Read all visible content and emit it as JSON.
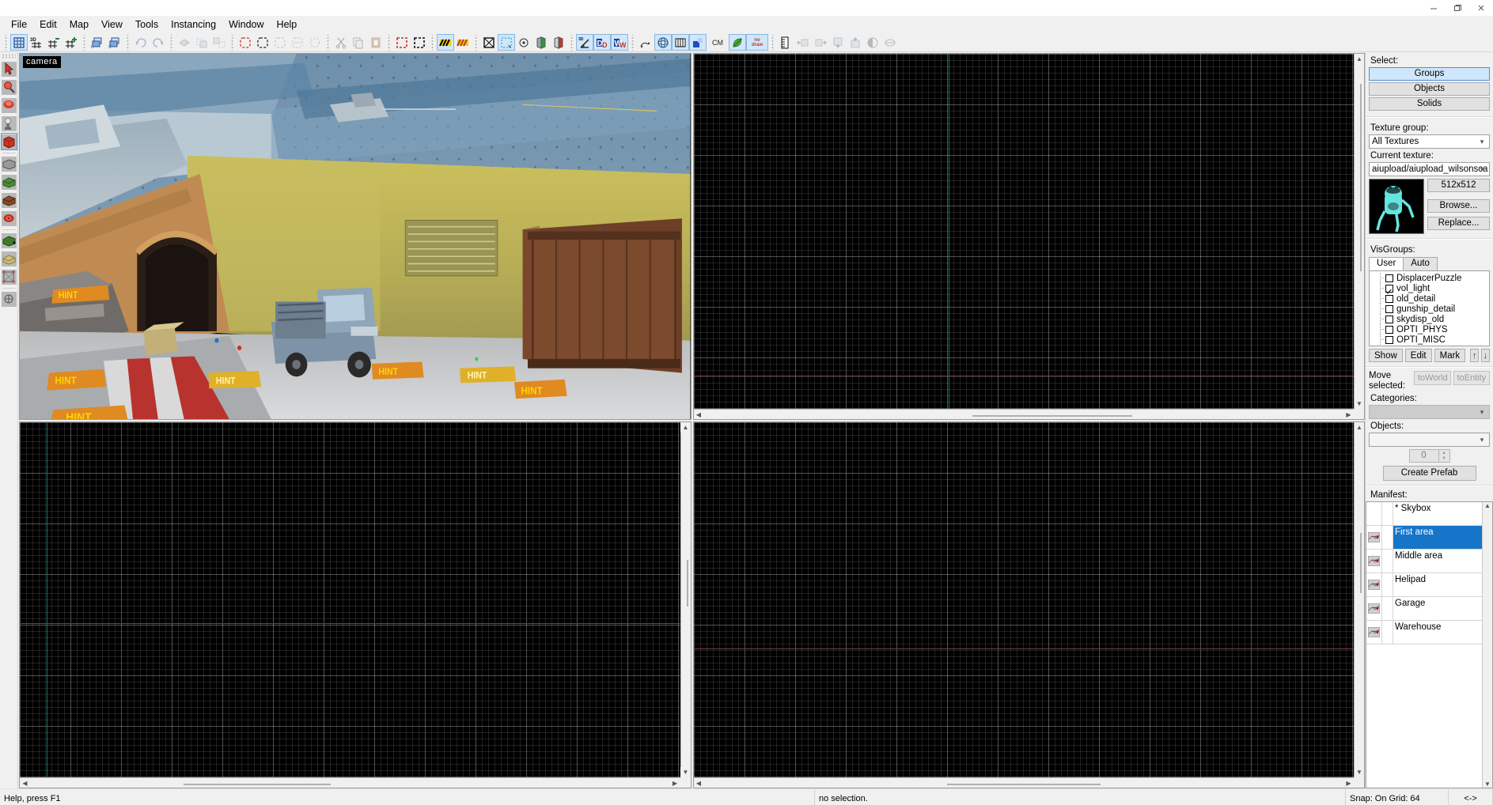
{
  "window": {
    "minimize": "–",
    "maximize": "❐",
    "close": "✕"
  },
  "menubar": {
    "items": [
      {
        "label": "File"
      },
      {
        "label": "Edit"
      },
      {
        "label": "Map"
      },
      {
        "label": "View"
      },
      {
        "label": "Tools"
      },
      {
        "label": "Instancing"
      },
      {
        "label": "Window"
      },
      {
        "label": "Help"
      }
    ]
  },
  "toolbar": {
    "groups": [
      {
        "name": "grid-tools",
        "buttons": [
          {
            "name": "toggle-2d-grid",
            "glyph": "grid2d",
            "active": true
          },
          {
            "name": "toggle-3d-grid",
            "glyph": "grid3d",
            "active": false
          },
          {
            "name": "grid-smaller",
            "glyph": "gridminus",
            "active": false
          },
          {
            "name": "grid-bigger",
            "glyph": "gridplus",
            "active": false
          }
        ]
      },
      {
        "name": "group-tools",
        "buttons": [
          {
            "name": "load-group",
            "glyph": "groupload",
            "active": false
          },
          {
            "name": "save-group",
            "glyph": "groupsave",
            "active": false
          }
        ]
      },
      {
        "name": "history-tools",
        "buttons": [
          {
            "name": "undo",
            "glyph": "undo",
            "active": false,
            "disabled": true
          },
          {
            "name": "redo",
            "glyph": "redo",
            "active": false,
            "disabled": true
          }
        ]
      },
      {
        "name": "carve-tools",
        "buttons": [
          {
            "name": "carve",
            "glyph": "carve",
            "active": false,
            "disabled": true
          },
          {
            "name": "group",
            "glyph": "group",
            "active": false,
            "disabled": true
          },
          {
            "name": "ungroup",
            "glyph": "ungroup",
            "active": false,
            "disabled": true
          }
        ]
      },
      {
        "name": "selection-mode-tools",
        "buttons": [
          {
            "name": "select-groups",
            "glyph": "selgroups",
            "active": false
          },
          {
            "name": "select-objects",
            "glyph": "selobjects",
            "active": false
          },
          {
            "name": "select-solids",
            "glyph": "selsolids",
            "active": false,
            "disabled": true
          },
          {
            "name": "ignore-groups",
            "glyph": "ignoregroups",
            "active": false,
            "disabled": true
          },
          {
            "name": "hide-selection",
            "glyph": "hidesel",
            "active": false,
            "disabled": true
          }
        ]
      },
      {
        "name": "clipboard-tools",
        "buttons": [
          {
            "name": "cut",
            "glyph": "cut",
            "active": false,
            "disabled": true
          },
          {
            "name": "copy",
            "glyph": "copy",
            "active": false,
            "disabled": true
          },
          {
            "name": "paste",
            "glyph": "paste",
            "active": false,
            "disabled": true
          }
        ]
      },
      {
        "name": "cordon-tools",
        "buttons": [
          {
            "name": "toggle-cordon",
            "glyph": "cordon1",
            "active": false
          },
          {
            "name": "edit-cordon",
            "glyph": "cordon2",
            "active": false
          }
        ]
      },
      {
        "name": "texture-lock-tools",
        "buttons": [
          {
            "name": "texture-lock",
            "glyph": "texlock",
            "active": true
          },
          {
            "name": "texture-scale-lock",
            "glyph": "texscalelock",
            "active": false
          }
        ]
      },
      {
        "name": "view-helper-tools",
        "buttons": [
          {
            "name": "toggle-helpers",
            "glyph": "helpers",
            "active": false
          },
          {
            "name": "toggle-texture-tool",
            "glyph": "tltool",
            "active": true
          },
          {
            "name": "toggle-texture-axes",
            "glyph": "texaxes",
            "active": false
          },
          {
            "name": "toggle-models",
            "glyph": "models1",
            "active": false
          },
          {
            "name": "toggle-models-fade",
            "glyph": "models2",
            "active": false
          }
        ]
      },
      {
        "name": "display-tools",
        "buttons": [
          {
            "name": "show-angles",
            "glyph": "angles",
            "active": true
          },
          {
            "name": "show-displacements",
            "glyph": "dispd",
            "active": true
          },
          {
            "name": "show-detail",
            "glyph": "dispw",
            "active": true
          }
        ]
      },
      {
        "name": "render-tools",
        "buttons": [
          {
            "name": "radius-culling",
            "glyph": "radius",
            "active": false
          },
          {
            "name": "world-sphere",
            "glyph": "sphere",
            "active": true
          },
          {
            "name": "show-grid-overlay",
            "glyph": "gridoverlay",
            "active": true
          },
          {
            "name": "show-lightmap",
            "glyph": "lightmap",
            "active": true
          },
          {
            "name": "cordon-mode",
            "glyph": "cm-text",
            "label": "CM",
            "active": false
          },
          {
            "name": "show-detail-leaf",
            "glyph": "leaf",
            "active": true
          },
          {
            "name": "nodraw-toggle",
            "glyph": "nodraw",
            "label": "no draw",
            "active": true
          }
        ]
      },
      {
        "name": "instance-tools",
        "buttons": [
          {
            "name": "manifest-ruler",
            "glyph": "ruler",
            "active": false
          },
          {
            "name": "move-to-previous",
            "glyph": "moveprev",
            "active": false,
            "disabled": true
          },
          {
            "name": "move-to-next",
            "glyph": "movenext",
            "active": false,
            "disabled": true
          },
          {
            "name": "collapse-instance",
            "glyph": "collapse",
            "active": false,
            "disabled": true
          },
          {
            "name": "push-into-instance",
            "glyph": "pushin",
            "active": false,
            "disabled": true
          },
          {
            "name": "half-visible",
            "glyph": "halfvis",
            "active": false,
            "disabled": true
          },
          {
            "name": "hidden-toggle",
            "glyph": "hidetog",
            "active": false,
            "disabled": true
          }
        ]
      }
    ]
  },
  "lefttools": {
    "buttons": [
      {
        "name": "selection-tool",
        "glyph": "arrow",
        "active": false
      },
      {
        "name": "magnify-tool",
        "glyph": "magnify",
        "active": false
      },
      {
        "name": "camera-tool",
        "glyph": "camera",
        "active": false
      },
      {
        "name": "entity-tool",
        "glyph": "entity",
        "active": false
      },
      {
        "name": "block-tool",
        "glyph": "block",
        "active": true
      },
      {
        "name": "toggle-texture-app",
        "glyph": "texapply",
        "active": false
      },
      {
        "name": "apply-current-texture",
        "glyph": "texdecal",
        "active": false
      },
      {
        "name": "apply-decals",
        "glyph": "decal",
        "active": false
      },
      {
        "name": "clipping-tool",
        "glyph": "clip",
        "active": false
      },
      {
        "name": "vertex-tool",
        "glyph": "vertex",
        "active": false
      },
      {
        "name": "displacement-tool",
        "glyph": "disp",
        "active": false
      },
      {
        "name": "overlay-tool",
        "glyph": "overlay",
        "active": false
      },
      {
        "name": "sculpt-tool",
        "glyph": "sculpt",
        "active": false
      }
    ]
  },
  "viewports": {
    "topleft": {
      "label": "camera",
      "type": "3d"
    },
    "topright": {
      "label": "",
      "type": "2d-top"
    },
    "bottomleft": {
      "label": "",
      "type": "2d-front"
    },
    "bottomright": {
      "label": "",
      "type": "2d-side"
    }
  },
  "rightpanel": {
    "select": {
      "label": "Select:",
      "options": [
        {
          "label": "Groups",
          "selected": true
        },
        {
          "label": "Objects",
          "selected": false
        },
        {
          "label": "Solids",
          "selected": false
        }
      ]
    },
    "texture": {
      "group_label": "Texture group:",
      "group_value": "All Textures",
      "current_label": "Current texture:",
      "current_value": "aiupload/aiupload_wilsonsca",
      "size": "512x512",
      "browse_label": "Browse...",
      "replace_label": "Replace..."
    },
    "visgroups": {
      "label": "VisGroups:",
      "tabs": [
        {
          "label": "User",
          "active": true
        },
        {
          "label": "Auto",
          "active": false
        }
      ],
      "items": [
        {
          "label": "DisplacerPuzzle",
          "checked": false
        },
        {
          "label": "vol_light",
          "checked": true
        },
        {
          "label": "old_detail",
          "checked": false
        },
        {
          "label": "gunship_detail",
          "checked": false
        },
        {
          "label": "skydisp_old",
          "checked": false
        },
        {
          "label": "OPTI_PHYS",
          "checked": false
        },
        {
          "label": "OPTI_MISC",
          "checked": false
        }
      ],
      "actions": [
        {
          "label": "Show"
        },
        {
          "label": "Edit"
        },
        {
          "label": "Mark"
        }
      ],
      "move_up": "↑",
      "move_down": "↓"
    },
    "prefabs": {
      "move_label_line1": "Move",
      "move_label_line2": "selected:",
      "to_world": "toWorld",
      "to_entity": "toEntity",
      "categories_label": "Categories:",
      "categories_value": "",
      "objects_label": "Objects:",
      "objects_value": "",
      "count": "0",
      "create_prefab": "Create Prefab"
    },
    "manifest": {
      "label": "Manifest:",
      "items": [
        {
          "label": "* Skybox",
          "selected": false,
          "has_icon": false
        },
        {
          "label": "First area",
          "selected": true,
          "has_icon": true
        },
        {
          "label": "Middle area",
          "selected": false,
          "has_icon": true
        },
        {
          "label": "Helipad",
          "selected": false,
          "has_icon": true
        },
        {
          "label": "Garage",
          "selected": false,
          "has_icon": true
        },
        {
          "label": "Warehouse",
          "selected": false,
          "has_icon": true
        }
      ]
    }
  },
  "statusbar": {
    "help": "Help, press F1",
    "selection": "no selection.",
    "snap": "Snap: On Grid: 64",
    "coords": "<->"
  },
  "colors": {
    "accent": "#1675c8",
    "toolbar_active": "#cfe6fb",
    "panel_bg": "#f0f0f0",
    "viewport_bg": "#000000",
    "wire_yellow": "#b5b000",
    "wire_cyan": "#26e2e2",
    "wire_teal": "#79c9b6",
    "hint_orange": "#e08a22"
  }
}
